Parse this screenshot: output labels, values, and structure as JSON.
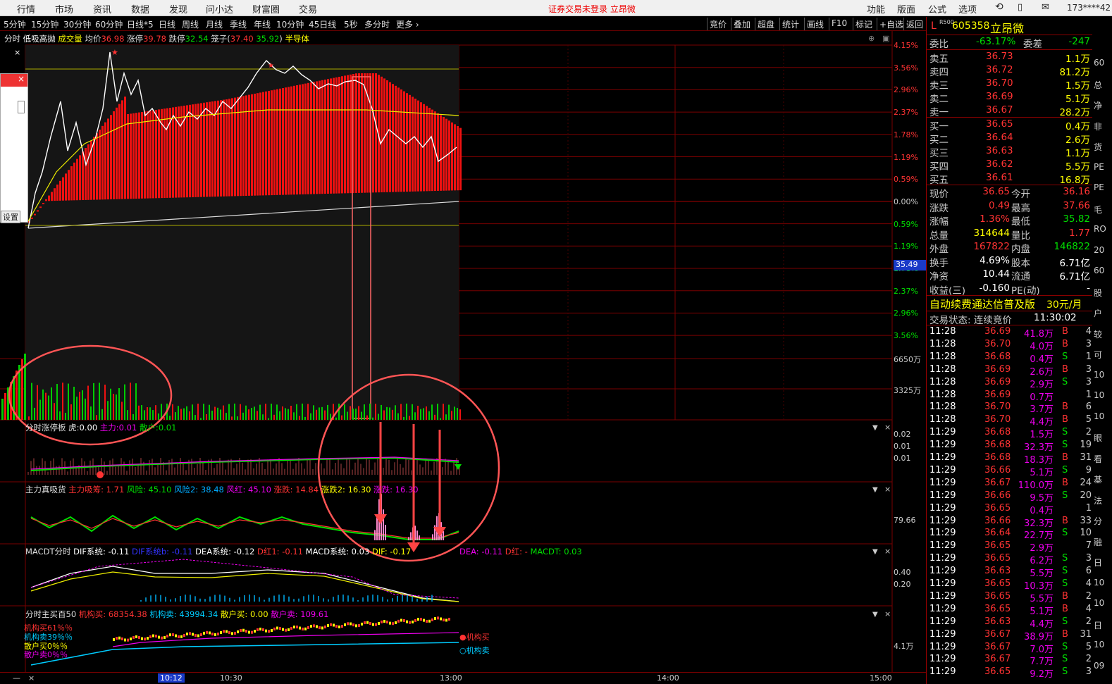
{
  "menu": {
    "items": [
      "行情",
      "市场",
      "资讯",
      "数据",
      "发现",
      "问小达",
      "财富圈",
      "交易"
    ],
    "status": "证券交易未登录  立昂微",
    "right_items": [
      "功能",
      "版面",
      "公式",
      "选项"
    ],
    "user": "173****42"
  },
  "periods": [
    "5分钟",
    "15分钟",
    "30分钟",
    "60分钟",
    "日线*5",
    "日线",
    "周线",
    "月线",
    "季线",
    "年线",
    "10分钟",
    "45日线",
    "5秒",
    "多分时",
    "更多"
  ],
  "toolbar": [
    "竞价",
    "叠加",
    "超盘",
    "统计",
    "画线",
    "F10",
    "标记",
    "+自选",
    "返回"
  ],
  "header": {
    "mode": "分时",
    "strategy": "低吸高抛",
    "vol": "成交量",
    "avg_label": "均价",
    "avg_val": "36.98",
    "up_label": "涨停",
    "up_val": "39.78",
    "down_label": "跌停",
    "down_val": "32.54",
    "cage": "笼子(",
    "cage_a": "37.40",
    "cage_b": "35.92",
    "cage_end": ")",
    "sector": "半导体"
  },
  "yaxis": [
    "4.15%",
    "3.56%",
    "2.96%",
    "2.37%",
    "1.78%",
    "1.19%",
    "0.59%",
    "0.00%",
    "0.59%",
    "1.19%",
    "1.78%",
    "2.37%",
    "2.96%",
    "3.56%"
  ],
  "cursor_price": "35.49",
  "vol_axis": [
    "6650万",
    "3325万"
  ],
  "panels": {
    "zt": {
      "title": "分时涨停板",
      "a_label": "虎:",
      "a": "0.00",
      "b_label": "主力:",
      "b": "0.01",
      "c_label": "散户:",
      "c": "0.01",
      "axis": [
        "0.02",
        "0.01",
        "0.01"
      ]
    },
    "zl": {
      "title": "主力真吸货",
      "items": [
        "主力吸筹: 1.71",
        "风险: 45.10",
        "风险2: 38.48",
        "风红: 45.10",
        "涨跌: 14.84",
        "涨跌2: 16.30",
        "涨跌: 16.30"
      ],
      "axis": [
        "79.66"
      ]
    },
    "macd": {
      "title": "MACDT分时",
      "items": [
        "DIF系统: -0.11",
        "DIF系统b: -0.11",
        "DEA系统: -0.12",
        "D红1: -0.11",
        "MACD系统: 0.03",
        "DIF: -0.17",
        "DEA: -0.11",
        "D红: -",
        "MACDT: 0.03"
      ],
      "axis": [
        "0.40",
        "0.20"
      ]
    },
    "zm": {
      "title": "分时主买百50",
      "items": [
        "机构买: 68354.38",
        "机构卖: 43994.34",
        "散户买: 0.00",
        "散户卖: 109.61"
      ],
      "legend": [
        "机构买61％％",
        "机构卖39％％",
        "散户买0％％",
        "散户卖0％％"
      ],
      "tags": [
        "●机构买",
        "○机构卖"
      ],
      "axis": [
        "4.1万"
      ]
    }
  },
  "left_popup": {
    "button": "设置",
    "close": "×"
  },
  "time_axis": {
    "cursor": "10:12",
    "ticks": [
      "10:30",
      "13:00",
      "14:00",
      "15:00"
    ]
  },
  "quote": {
    "code": "605358",
    "name": "立昂微",
    "badge": "L",
    "weibi_label": "委比",
    "weibi": "-63.17%",
    "weicha_label": "委差",
    "weicha": "-247",
    "asks": [
      {
        "label": "卖五",
        "price": "36.73",
        "vol": "1.1万"
      },
      {
        "label": "卖四",
        "price": "36.72",
        "vol": "81.2万"
      },
      {
        "label": "卖三",
        "price": "36.70",
        "vol": "1.5万"
      },
      {
        "label": "卖二",
        "price": "36.69",
        "vol": "5.1万"
      },
      {
        "label": "卖一",
        "price": "36.67",
        "vol": "28.2万"
      }
    ],
    "bids": [
      {
        "label": "买一",
        "price": "36.65",
        "vol": "0.4万"
      },
      {
        "label": "买二",
        "price": "36.64",
        "vol": "2.6万"
      },
      {
        "label": "买三",
        "price": "36.63",
        "vol": "1.1万"
      },
      {
        "label": "买四",
        "price": "36.62",
        "vol": "5.5万"
      },
      {
        "label": "买五",
        "price": "36.61",
        "vol": "16.8万"
      }
    ],
    "stats": [
      {
        "l1": "现价",
        "v1": "36.65",
        "l2": "今开",
        "v2": "36.16"
      },
      {
        "l1": "涨跌",
        "v1": "0.49",
        "l2": "最高",
        "v2": "37.66"
      },
      {
        "l1": "涨幅",
        "v1": "1.36%",
        "l2": "最低",
        "v2": "35.82"
      },
      {
        "l1": "总量",
        "v1": "314644",
        "l2": "量比",
        "v2": "1.77"
      },
      {
        "l1": "外盘",
        "v1": "167822",
        "l2": "内盘",
        "v2": "146822"
      },
      {
        "l1": "换手",
        "v1": "4.69%",
        "l2": "股本",
        "v2": "6.71亿"
      },
      {
        "l1": "净资",
        "v1": "10.44",
        "l2": "流通",
        "v2": "6.71亿"
      },
      {
        "l1": "收益(三)",
        "v1": "-0.160",
        "l2": "PE(动)",
        "v2": "-"
      }
    ],
    "promo": "自动续费通达信普及版",
    "promo_price": "30元/月",
    "trade_state": "交易状态: 连续竞价",
    "trade_time": "11:30:02",
    "ticks": [
      {
        "t": "11:28",
        "p": "36.69",
        "v": "41.8万",
        "d": "B",
        "n": "4"
      },
      {
        "t": "11:28",
        "p": "36.70",
        "v": "4.0万",
        "d": "B",
        "n": "3"
      },
      {
        "t": "11:28",
        "p": "36.68",
        "v": "0.4万",
        "d": "S",
        "n": "1"
      },
      {
        "t": "11:28",
        "p": "36.69",
        "v": "2.6万",
        "d": "B",
        "n": "3"
      },
      {
        "t": "11:28",
        "p": "36.69",
        "v": "2.9万",
        "d": "S",
        "n": "3"
      },
      {
        "t": "11:28",
        "p": "36.69",
        "v": "0.7万",
        "d": "",
        "n": "1"
      },
      {
        "t": "11:28",
        "p": "36.70",
        "v": "3.7万",
        "d": "B",
        "n": "6"
      },
      {
        "t": "11:28",
        "p": "36.70",
        "v": "4.4万",
        "d": "B",
        "n": "5"
      },
      {
        "t": "11:29",
        "p": "36.68",
        "v": "1.5万",
        "d": "S",
        "n": "2"
      },
      {
        "t": "11:29",
        "p": "36.68",
        "v": "32.3万",
        "d": "S",
        "n": "19"
      },
      {
        "t": "11:29",
        "p": "36.68",
        "v": "18.3万",
        "d": "B",
        "n": "31"
      },
      {
        "t": "11:29",
        "p": "36.66",
        "v": "5.1万",
        "d": "S",
        "n": "9"
      },
      {
        "t": "11:29",
        "p": "36.67",
        "v": "110.0万",
        "d": "B",
        "n": "24"
      },
      {
        "t": "11:29",
        "p": "36.66",
        "v": "9.5万",
        "d": "S",
        "n": "20"
      },
      {
        "t": "11:29",
        "p": "36.65",
        "v": "0.4万",
        "d": "",
        "n": "1"
      },
      {
        "t": "11:29",
        "p": "36.66",
        "v": "32.3万",
        "d": "B",
        "n": "33"
      },
      {
        "t": "11:29",
        "p": "36.64",
        "v": "22.7万",
        "d": "S",
        "n": "10"
      },
      {
        "t": "11:29",
        "p": "36.65",
        "v": "2.9万",
        "d": "",
        "n": "7"
      },
      {
        "t": "11:29",
        "p": "36.65",
        "v": "6.2万",
        "d": "S",
        "n": "3"
      },
      {
        "t": "11:29",
        "p": "36.63",
        "v": "5.5万",
        "d": "S",
        "n": "6"
      },
      {
        "t": "11:29",
        "p": "36.65",
        "v": "10.3万",
        "d": "S",
        "n": "4"
      },
      {
        "t": "11:29",
        "p": "36.65",
        "v": "5.5万",
        "d": "B",
        "n": "2"
      },
      {
        "t": "11:29",
        "p": "36.65",
        "v": "5.1万",
        "d": "B",
        "n": "4"
      },
      {
        "t": "11:29",
        "p": "36.63",
        "v": "4.4万",
        "d": "S",
        "n": "2"
      },
      {
        "t": "11:29",
        "p": "36.67",
        "v": "38.9万",
        "d": "B",
        "n": "31"
      },
      {
        "t": "11:29",
        "p": "36.67",
        "v": "7.0万",
        "d": "S",
        "n": "5"
      },
      {
        "t": "11:29",
        "p": "36.67",
        "v": "7.7万",
        "d": "S",
        "n": "2"
      },
      {
        "t": "11:29",
        "p": "36.65",
        "v": "9.2万",
        "d": "S",
        "n": "3"
      }
    ]
  },
  "far_right": [
    "60",
    "总",
    "净",
    "非",
    "货",
    "PE",
    "PE",
    "毛",
    "RO",
    "20",
    "60",
    "股",
    "户",
    "较",
    "可",
    "10",
    "10",
    "10",
    "眼",
    "看",
    "基",
    "法",
    "分",
    "融",
    "日",
    "10",
    "10",
    "日",
    "10",
    "09"
  ],
  "colors": {
    "up": "#ff3b3b",
    "down": "#00d000",
    "yellow": "#ffff00",
    "grid": "#7a0000"
  }
}
